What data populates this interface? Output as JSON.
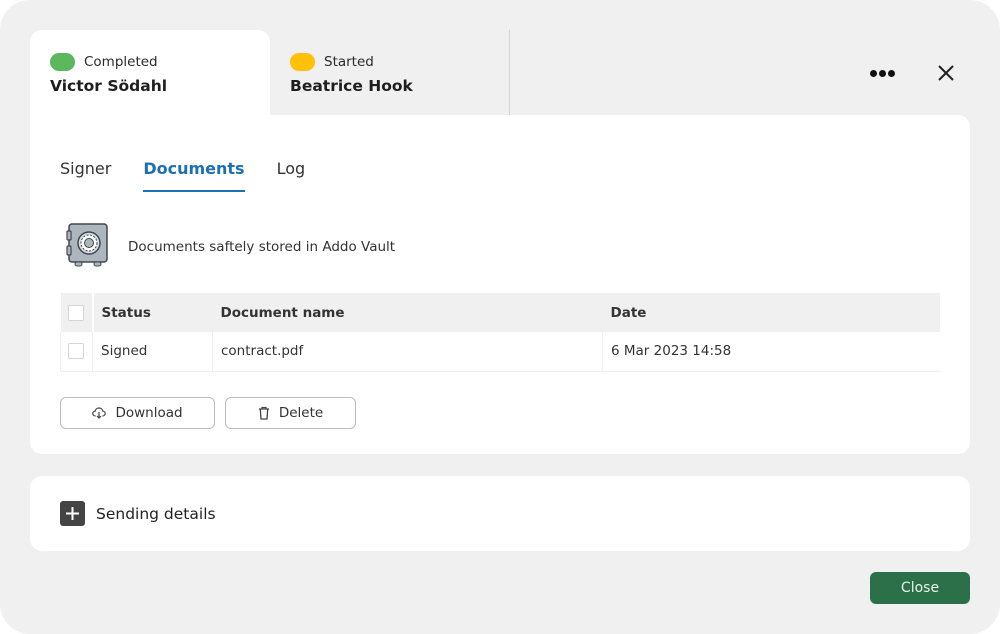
{
  "signers": [
    {
      "status": "Completed",
      "status_color": "#5cb85c",
      "name": "Victor Södahl",
      "active": true
    },
    {
      "status": "Started",
      "status_color": "#ffc107",
      "name": "Beatrice  Hook",
      "active": false
    }
  ],
  "header": {
    "more_icon": "more-horizontal-icon",
    "close_icon": "close-icon"
  },
  "subtabs": [
    {
      "label": "Signer",
      "active": false
    },
    {
      "label": "Documents",
      "active": true
    },
    {
      "label": "Log",
      "active": false
    }
  ],
  "vault": {
    "icon": "safe-vault-icon",
    "message": "Documents saftely stored in Addo Vault"
  },
  "table": {
    "columns": [
      "Status",
      "Document name",
      "Date"
    ],
    "rows": [
      {
        "status": "Signed",
        "name": "contract.pdf",
        "date": "6 Mar 2023 14:58",
        "checked": false
      }
    ]
  },
  "actions": {
    "download_label": "Download",
    "delete_label": "Delete"
  },
  "sending_details": {
    "label": "Sending details"
  },
  "footer": {
    "close_label": "Close",
    "accent": "#2b7049"
  },
  "colors": {
    "active_tab": "#1c6fb0",
    "background": "#f0f0f0"
  }
}
